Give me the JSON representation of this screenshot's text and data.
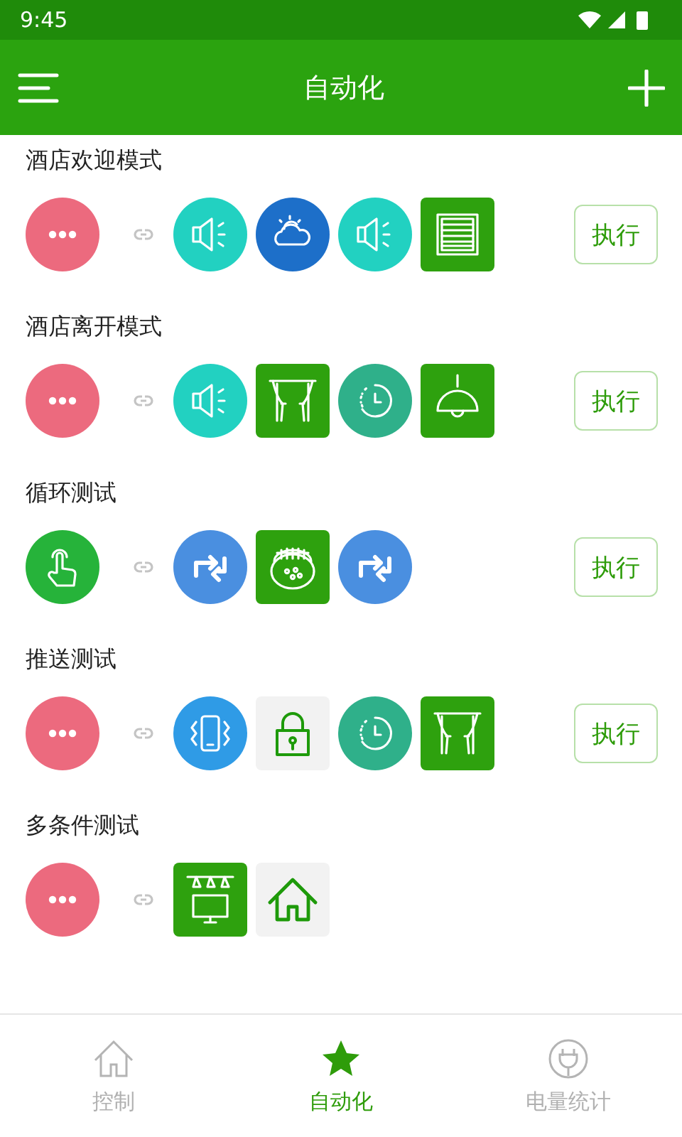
{
  "status_bar": {
    "time": "9:45"
  },
  "app_bar": {
    "title": "自动化"
  },
  "scenes": [
    {
      "name": "酒店欢迎模式",
      "trigger": {
        "kind": "more",
        "round": true,
        "color": "#ec6a7e"
      },
      "actions": [
        {
          "kind": "speaker",
          "round": true,
          "color": "#22d1c1"
        },
        {
          "kind": "weather",
          "round": true,
          "color": "#1d6fc9"
        },
        {
          "kind": "speaker",
          "round": true,
          "color": "#22d1c1"
        },
        {
          "kind": "blind",
          "round": false,
          "color": "#2ea10e"
        }
      ],
      "execute_button": "执行"
    },
    {
      "name": "酒店离开模式",
      "trigger": {
        "kind": "more",
        "round": true,
        "color": "#ec6a7e"
      },
      "actions": [
        {
          "kind": "speaker",
          "round": true,
          "color": "#22d1c1"
        },
        {
          "kind": "curtain",
          "round": false,
          "color": "#2ea10e"
        },
        {
          "kind": "timer",
          "round": true,
          "color": "#2fb08a"
        },
        {
          "kind": "lamp",
          "round": false,
          "color": "#2ea10e"
        }
      ],
      "execute_button": "执行"
    },
    {
      "name": "循环测试",
      "trigger": {
        "kind": "touch",
        "round": true,
        "color": "#26b33a"
      },
      "actions": [
        {
          "kind": "repeat",
          "round": true,
          "color": "#4a8fe0"
        },
        {
          "kind": "sensor",
          "round": false,
          "color": "#2ea10e"
        },
        {
          "kind": "repeat",
          "round": true,
          "color": "#4a8fe0"
        }
      ],
      "execute_button": "执行"
    },
    {
      "name": "推送测试",
      "trigger": {
        "kind": "more",
        "round": true,
        "color": "#ec6a7e"
      },
      "actions": [
        {
          "kind": "vibrate",
          "round": true,
          "color": "#2f9be6"
        },
        {
          "kind": "lock",
          "round": false,
          "color": "#f2f2f2"
        },
        {
          "kind": "timer",
          "round": true,
          "color": "#2fb08a"
        },
        {
          "kind": "curtain",
          "round": false,
          "color": "#2ea10e"
        }
      ],
      "execute_button": "执行"
    },
    {
      "name": "多条件测试",
      "trigger": {
        "kind": "more",
        "round": true,
        "color": "#ec6a7e"
      },
      "actions": [
        {
          "kind": "tv",
          "round": false,
          "color": "#2ea10e"
        },
        {
          "kind": "home",
          "round": false,
          "color": "#f2f2f2"
        }
      ]
    }
  ],
  "bottom_nav": [
    {
      "kind": "home",
      "label": "控制",
      "selected": false
    },
    {
      "kind": "star",
      "label": "自动化",
      "selected": true
    },
    {
      "kind": "plug",
      "label": "电量统计",
      "selected": false
    }
  ]
}
